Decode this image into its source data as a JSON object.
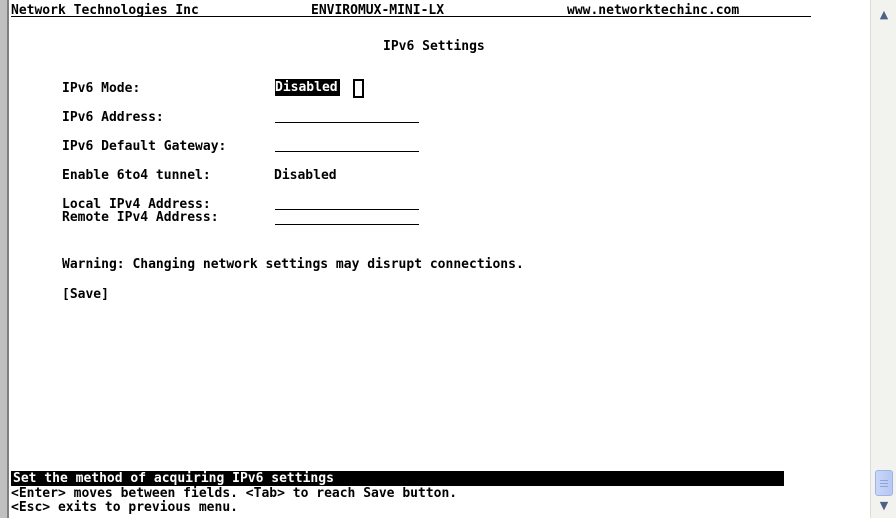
{
  "header": {
    "company": "Network Technologies Inc",
    "product": "ENVIROMUX-MINI-LX",
    "website": "www.networktechinc.com"
  },
  "page_title": "IPv6 Settings",
  "fields": {
    "ipv6_mode": {
      "label": "IPv6 Mode:",
      "value": "Disabled"
    },
    "ipv6_address": {
      "label": "IPv6 Address:",
      "value": ""
    },
    "ipv6_gateway": {
      "label": "IPv6 Default Gateway:",
      "value": ""
    },
    "tunnel_6to4": {
      "label": "Enable 6to4 tunnel:",
      "value": "Disabled"
    },
    "local_ipv4": {
      "label": "Local IPv4 Address:",
      "value": ""
    },
    "remote_ipv4": {
      "label": "Remote IPv4 Address:",
      "value": ""
    }
  },
  "warning": "Warning: Changing network settings may disrupt connections.",
  "save_label": "[Save]",
  "status": {
    "hint": "Set the method of acquiring IPv6 settings",
    "help_line1": "<Enter> moves between fields. <Tab> to reach Save button.",
    "help_line2": "<Esc> exits to previous menu."
  },
  "scrollbar": {
    "up_icon": "scroll-up-arrow",
    "down_icon": "scroll-down-arrow",
    "position": 1.0
  }
}
